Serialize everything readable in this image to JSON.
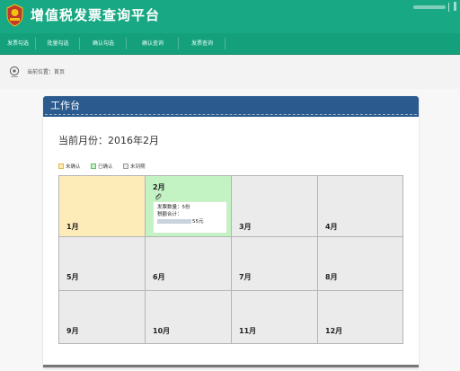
{
  "header": {
    "title": "增值税发票查询平台",
    "brand_color": "#18a884",
    "nav_color": "#15a07c"
  },
  "nav": {
    "items": [
      {
        "label": "发票勾选"
      },
      {
        "label": "批量勾选"
      },
      {
        "label": "确认勾选"
      },
      {
        "label": "确认查询"
      },
      {
        "label": "发票查询"
      }
    ]
  },
  "breadcrumb": {
    "text": "当前位置：首页",
    "icon": "location-pin-icon"
  },
  "panel": {
    "title": "工作台",
    "header_color": "#2b5b8e"
  },
  "current_month": {
    "text": "当前月份：2016年2月"
  },
  "legend": [
    {
      "label": "未确认",
      "color": "#fdebb8",
      "border": "#e0b84a"
    },
    {
      "label": "已确认",
      "color": "#c3f2c3",
      "border": "#5fbf5f"
    },
    {
      "label": "未到期",
      "color": "#ebebeb",
      "border": "#999999"
    }
  ],
  "calendar": {
    "months": [
      {
        "label": "1月",
        "status": "unconfirmed"
      },
      {
        "label": "2月",
        "status": "confirmed",
        "current": true
      },
      {
        "label": "3月",
        "status": "pending"
      },
      {
        "label": "4月",
        "status": "pending"
      },
      {
        "label": "5月",
        "status": "pending"
      },
      {
        "label": "6月",
        "status": "pending"
      },
      {
        "label": "7月",
        "status": "pending"
      },
      {
        "label": "8月",
        "status": "pending"
      },
      {
        "label": "9月",
        "status": "pending"
      },
      {
        "label": "10月",
        "status": "pending"
      },
      {
        "label": "11月",
        "status": "pending"
      },
      {
        "label": "12月",
        "status": "pending"
      }
    ],
    "feb_detail": {
      "invoice_count": "发票数量：5份",
      "tax_total_label": "税额合计：",
      "tax_total_suffix": "55元",
      "icon": "paperclip-icon"
    }
  }
}
